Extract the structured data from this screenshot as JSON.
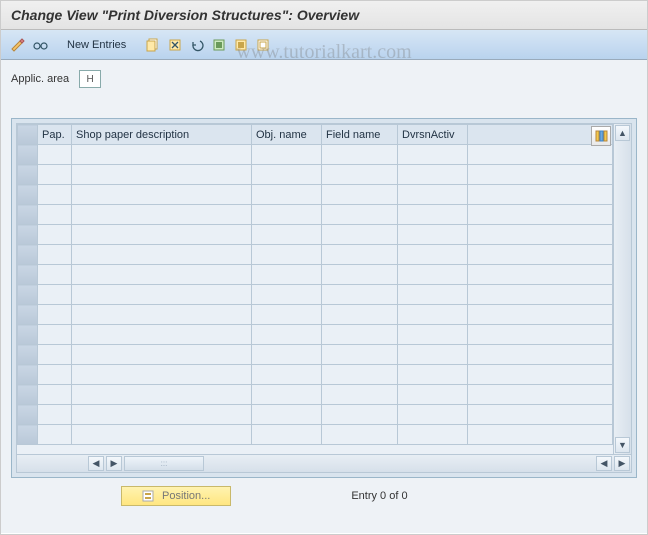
{
  "header": {
    "title": "Change View \"Print Diversion Structures\": Overview"
  },
  "toolbar": {
    "new_entries": "New Entries"
  },
  "fields": {
    "applic_area_label": "Applic. area",
    "applic_area_value": "H"
  },
  "table": {
    "columns": {
      "pap": "Pap.",
      "desc": "Shop paper description",
      "obj": "Obj. name",
      "field": "Field name",
      "dvrsn": "DvrsnActiv"
    },
    "row_count": 15
  },
  "footer": {
    "position_label": "Position...",
    "entry_text": "Entry 0 of 0"
  },
  "watermark": "www.tutorialkart.com"
}
